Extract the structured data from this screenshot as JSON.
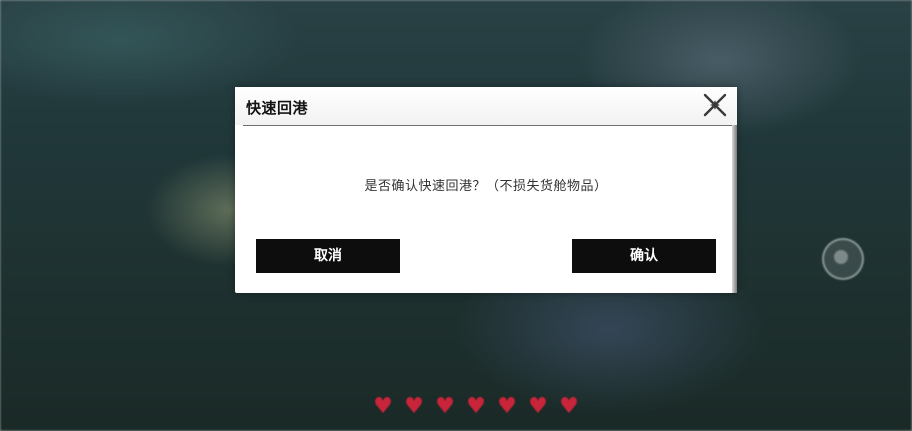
{
  "dialog": {
    "title": "快速回港",
    "message": "是否确认快速回港？（不损失货舱物品）",
    "cancel_label": "取消",
    "confirm_label": "确认",
    "close_icon": "close-x-icon"
  },
  "background_hud": {
    "hearts_count": 7,
    "heart_icon": "heart-icon",
    "joystick_icon": "joystick-icon"
  },
  "colors": {
    "button_bg": "#0d0d0d",
    "button_text": "#ffffff",
    "dialog_bg": "#ffffff",
    "heart": "#c8243a"
  }
}
